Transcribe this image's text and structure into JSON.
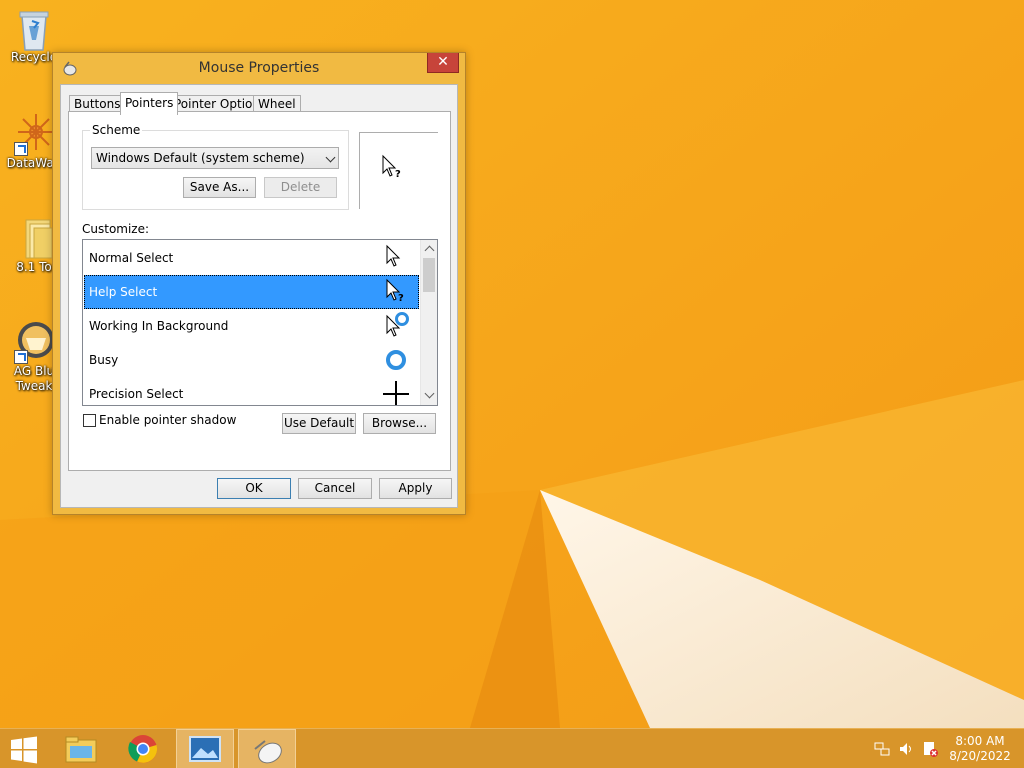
{
  "desktop": {
    "icons": [
      {
        "label": "Recycle"
      },
      {
        "label": "DataWag"
      },
      {
        "label": "8.1 To"
      },
      {
        "label": "AG Blu"
      },
      {
        "label": "Tweak"
      }
    ]
  },
  "dialog": {
    "title": "Mouse Properties",
    "close_glyph": "✕",
    "tabs": [
      {
        "label": "Buttons",
        "active": false
      },
      {
        "label": "Pointers",
        "active": true
      },
      {
        "label": "Pointer Options",
        "active": false
      },
      {
        "label": "Wheel",
        "active": false
      }
    ],
    "scheme": {
      "group_label": "Scheme",
      "selected": "Windows Default (system scheme)",
      "save_as_label": "Save As...",
      "delete_label": "Delete"
    },
    "customize": {
      "label": "Customize:",
      "items": [
        {
          "label": "Normal Select",
          "icon": "arrow-cursor-icon",
          "selected": false
        },
        {
          "label": "Help Select",
          "icon": "help-cursor-icon",
          "selected": true
        },
        {
          "label": "Working In Background",
          "icon": "working-cursor-icon",
          "selected": false
        },
        {
          "label": "Busy",
          "icon": "busy-cursor-icon",
          "selected": false
        },
        {
          "label": "Precision Select",
          "icon": "crosshair-cursor-icon",
          "selected": false
        }
      ]
    },
    "pointer_shadow": {
      "label": "Enable pointer shadow",
      "checked": false
    },
    "use_default_label": "Use Default",
    "browse_label": "Browse...",
    "ok_label": "OK",
    "cancel_label": "Cancel",
    "apply_label": "Apply"
  },
  "taskbar": {
    "time": "8:00 AM",
    "date": "8/20/2022"
  },
  "colors": {
    "wallpaper": "#f7a81b",
    "selection": "#3399ff",
    "title_bar": "#f1ba42",
    "close_button": "#c7443a"
  }
}
